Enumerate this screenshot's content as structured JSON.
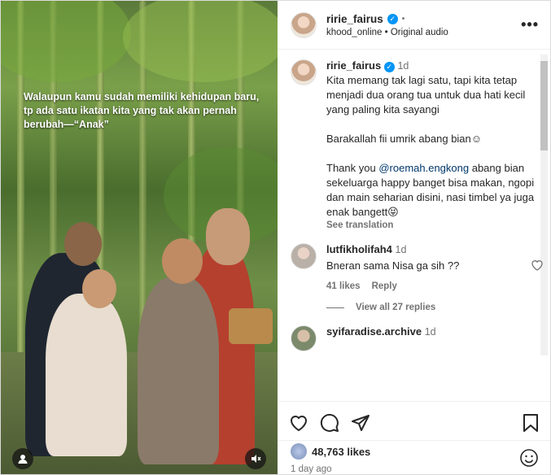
{
  "media": {
    "caption": "Walaupun kamu sudah memiliki kehidupan baru, tp ada satu ikatan kita yang tak akan pernah berubah—“Anak”",
    "icons": {
      "left": "user-tag-icon",
      "right": "mute-icon"
    }
  },
  "header": {
    "username": "ririe_fairus",
    "separator": "•",
    "audio_owner": "khood_online",
    "audio_sep": "•",
    "audio_label": "Original audio",
    "more_label": "•••"
  },
  "post": {
    "username": "ririe_fairus",
    "time": "1d",
    "caption_p1": "Kita memang tak lagi satu, tapi kita tetap menjadi dua orang tua untuk dua hati kecil yang paling kita sayangi",
    "caption_p2": "Barakallah fii umrik abang bian☺",
    "caption_p3_pre": "Thank you ",
    "caption_mention": "@roemah.engkong",
    "caption_p3_post": " abang bian sekeluarga happy banget bisa makan, ngopi dan main seharian disini, nasi timbel ya juga enak bangett😝",
    "see_translation": "See translation"
  },
  "comments": [
    {
      "username": "lutfikholifah4",
      "time": "1d",
      "text": "Bneran sama Nisa ga sih ??",
      "likes": "41 likes",
      "reply": "Reply",
      "view_replies": "View all 27 replies"
    },
    {
      "username": "syifaradise.archive",
      "time": "1d"
    }
  ],
  "footer": {
    "likes_count": "48,763 likes",
    "posted_ago": "1 day ago"
  },
  "colors": {
    "verified": "#0095f6",
    "mention": "#00376b",
    "muted": "#737373"
  }
}
